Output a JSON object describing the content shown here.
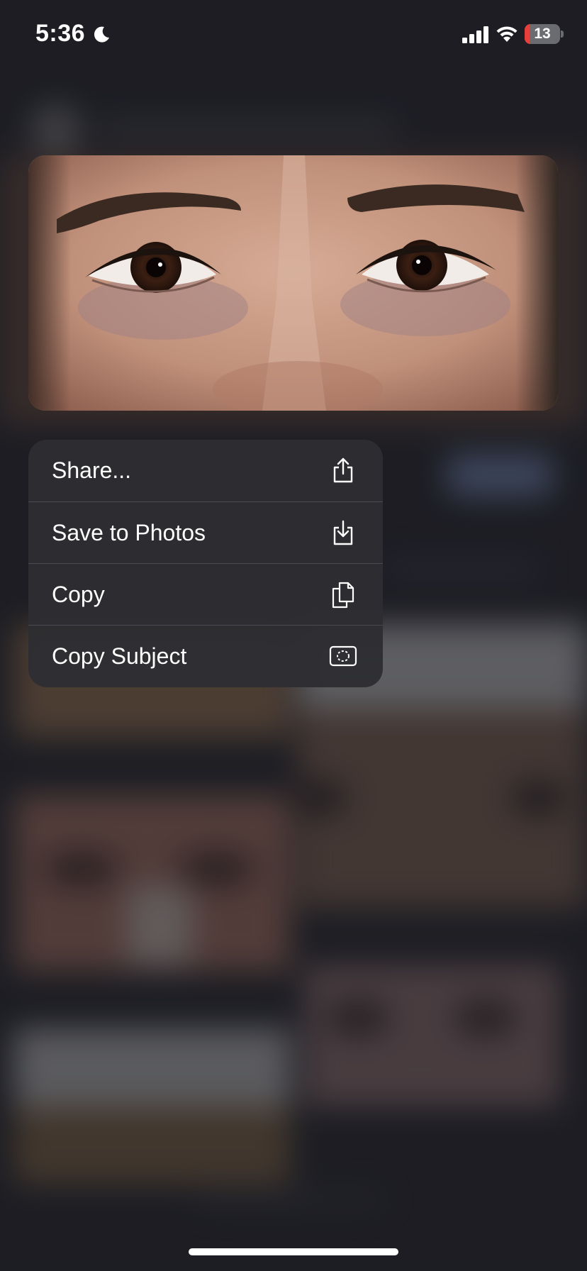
{
  "status_bar": {
    "time": "5:36",
    "moon_icon": "moon-icon",
    "signal_icon": "cellular-signal-icon",
    "wifi_icon": "wifi-icon",
    "battery_level": "13",
    "battery_color": "#e5403a"
  },
  "preview": {
    "subject": "close-up photo of a child's eyes"
  },
  "context_menu": {
    "items": [
      {
        "label": "Share...",
        "icon": "share-icon"
      },
      {
        "label": "Save to Photos",
        "icon": "save-to-photos-icon"
      },
      {
        "label": "Copy",
        "icon": "copy-icon"
      },
      {
        "label": "Copy Subject",
        "icon": "copy-subject-icon"
      }
    ]
  },
  "colors": {
    "menu_background": "#2e2e32",
    "menu_text": "#ffffff",
    "screen_background": "#222329"
  }
}
